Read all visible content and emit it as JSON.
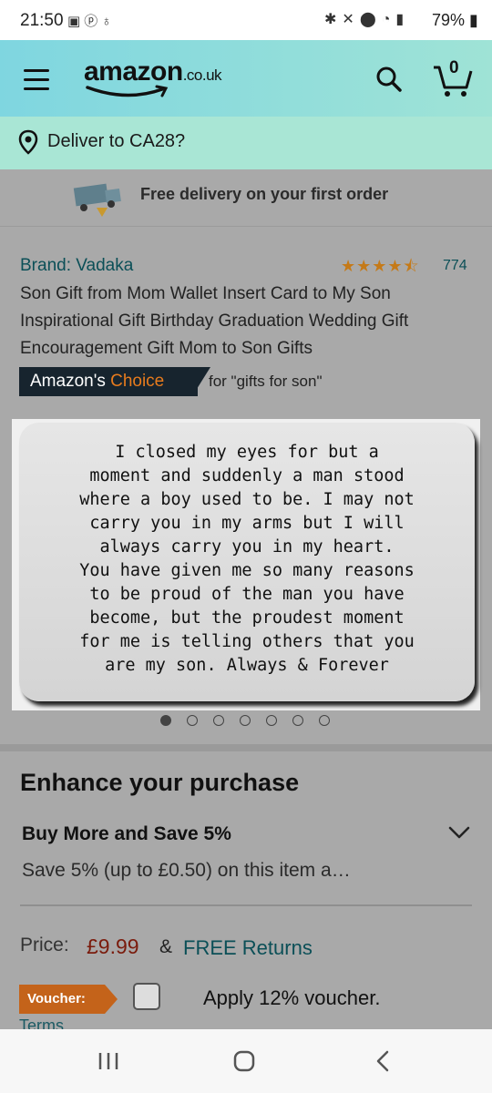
{
  "status_bar": {
    "time": "21:50",
    "battery": "79%",
    "left_icons": [
      "gallery-icon",
      "pinterest-icon",
      "notification-icon"
    ],
    "right_icons": [
      "bluetooth-icon",
      "mute-icon",
      "location-icon",
      "wifi-icon",
      "signal-icon",
      "battery-icon"
    ]
  },
  "header": {
    "logo_main": "amazon",
    "logo_tld": ".co.uk",
    "cart_count": "0",
    "colors": {
      "gradient_start": "#7fd6e0",
      "gradient_end": "#9fe3d6"
    }
  },
  "deliver": {
    "text": "Deliver to CA28?"
  },
  "promo": {
    "text": "Free delivery on your first order"
  },
  "product": {
    "brand": "Brand: Vadaka",
    "rating_stars": 4.5,
    "rating_count": "774",
    "title": "Son Gift from Mom Wallet Insert Card to My Son Inspirational Gift Birthday Graduation Wedding Gift Encouragement Gift Mom to Son Gifts",
    "choice_badge_prefix": "Amazon's ",
    "choice_badge_highlight": "Choice",
    "choice_for": "for \"gifts for son\"",
    "image_text": "I closed my eyes for but a\nmoment and suddenly a man stood\nwhere a boy used to be. I may not\ncarry you in my arms but I will\nalways carry you in my heart.\nYou have given me so many reasons\nto be proud of the man you have\nbecome, but the proudest moment\nfor me is telling others that you\nare my son. Always & Forever",
    "image_count": 7,
    "active_image": 1
  },
  "enhance": {
    "title": "Enhance your purchase",
    "offer_title": "Buy More and Save 5%",
    "offer_desc": "Save 5% (up to £0.50) on this item a…"
  },
  "pricing": {
    "label": "Price:",
    "price": "£9.99",
    "amp": "&",
    "returns": "FREE Returns",
    "voucher_badge": "Voucher:",
    "voucher_text": "Apply 12% voucher.",
    "terms": "Terms"
  },
  "colors": {
    "accent_teal": "#0b4f57",
    "price_red": "#7a1b0c",
    "choice_orange": "#e77b1d",
    "voucher_orange": "#c4631a",
    "overlay_gray": "#a9a9a9"
  }
}
